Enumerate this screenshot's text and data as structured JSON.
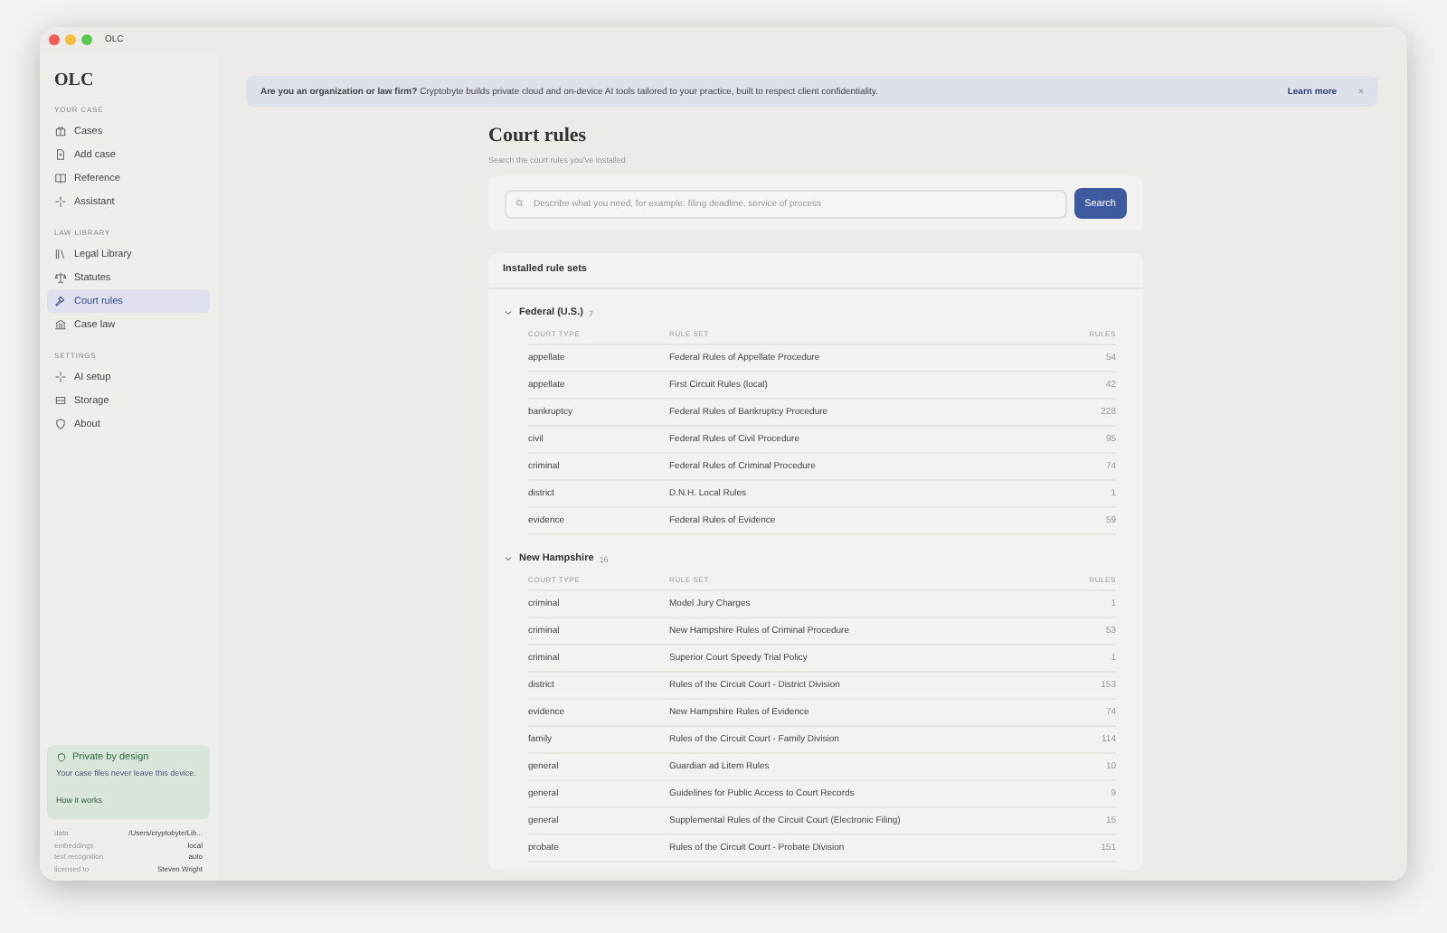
{
  "window": {
    "title": "OLC"
  },
  "sidebar": {
    "brand": "OLC",
    "sections": [
      {
        "heading": "YOUR CASE",
        "items": [
          {
            "label": "Cases",
            "selected": false
          },
          {
            "label": "Add case",
            "selected": false
          },
          {
            "label": "Reference",
            "selected": false
          },
          {
            "label": "Assistant",
            "selected": false
          }
        ]
      },
      {
        "heading": "LAW LIBRARY",
        "items": [
          {
            "label": "Legal Library",
            "selected": false
          },
          {
            "label": "Statutes",
            "selected": false
          },
          {
            "label": "Court rules",
            "selected": true
          },
          {
            "label": "Case law",
            "selected": false
          }
        ]
      },
      {
        "heading": "SETTINGS",
        "items": [
          {
            "label": "AI setup",
            "selected": false
          },
          {
            "label": "Storage",
            "selected": false
          },
          {
            "label": "About",
            "selected": false
          }
        ]
      }
    ],
    "privacy": {
      "title": "Private by design",
      "text": "Your case files never leave this device.",
      "link": "How it works"
    },
    "info": [
      {
        "key": "data",
        "value": "/Users/cryptobyte/Lib..."
      },
      {
        "key": "embeddings",
        "value": "local"
      },
      {
        "key": "text recognition",
        "value": "auto"
      },
      {
        "key": "licensed to",
        "value": "Steven Wright"
      }
    ]
  },
  "banner": {
    "lead": "Are you an organization or law firm?",
    "text": "Cryptobyte builds private cloud and on-device AI tools tailored to your practice, built to respect client confidentiality.",
    "link": "Learn more",
    "close": "×"
  },
  "page": {
    "title": "Court rules",
    "subtitle": "Search the court rules you've installed"
  },
  "search": {
    "placeholder": "Describe what you need, for example: filing deadline, service of process",
    "button": "Search"
  },
  "installed": {
    "title": "Installed rule sets",
    "groups": [
      {
        "name": "Federal (U.S.)",
        "count": "7",
        "expanded": true,
        "columns": [
          "COURT TYPE",
          "RULE SET",
          "RULES"
        ],
        "rows": [
          [
            "appellate",
            "Federal Rules of Appellate Procedure",
            "54"
          ],
          [
            "appellate",
            "First Circuit Rules (local)",
            "42"
          ],
          [
            "bankruptcy",
            "Federal Rules of Bankruptcy Procedure",
            "228"
          ],
          [
            "civil",
            "Federal Rules of Civil Procedure",
            "95"
          ],
          [
            "criminal",
            "Federal Rules of Criminal Procedure",
            "74"
          ],
          [
            "district",
            "D.N.H. Local Rules",
            "1"
          ],
          [
            "evidence",
            "Federal Rules of Evidence",
            "59"
          ]
        ]
      },
      {
        "name": "New Hampshire",
        "count": "16",
        "expanded": true,
        "columns": [
          "COURT TYPE",
          "RULE SET",
          "RULES"
        ],
        "rows": [
          [
            "criminal",
            "Model Jury Charges",
            "1"
          ],
          [
            "criminal",
            "New Hampshire Rules of Criminal Procedure",
            "53"
          ],
          [
            "criminal",
            "Superior Court Speedy Trial Policy",
            "1"
          ],
          [
            "district",
            "Rules of the Circuit Court - District Division",
            "153"
          ],
          [
            "evidence",
            "New Hampshire Rules of Evidence",
            "74"
          ],
          [
            "family",
            "Rules of the Circuit Court - Family Division",
            "114"
          ],
          [
            "general",
            "Guardian ad Litem Rules",
            "10"
          ],
          [
            "general",
            "Guidelines for Public Access to Court Records",
            "9"
          ],
          [
            "general",
            "Supplemental Rules of the Circuit Court (Electronic Filing)",
            "15"
          ],
          [
            "probate",
            "Rules of the Circuit Court - Probate Division",
            "151"
          ]
        ]
      }
    ]
  }
}
